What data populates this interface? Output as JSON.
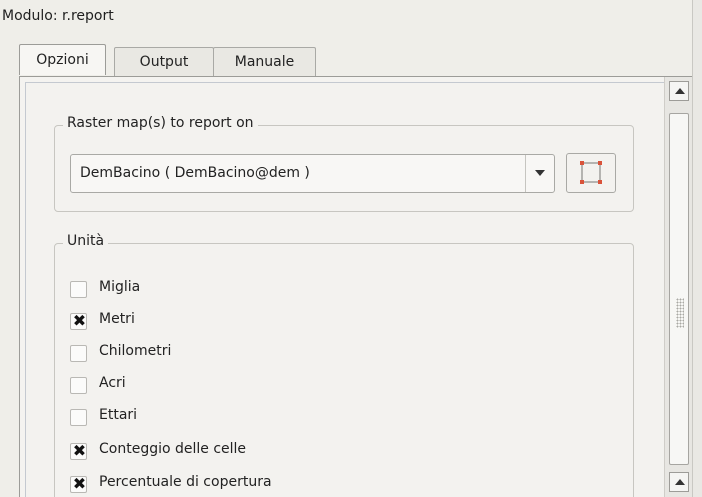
{
  "window": {
    "title": "Modulo: r.report"
  },
  "tabs": [
    {
      "label": "Opzioni",
      "active": true
    },
    {
      "label": "Output",
      "active": false
    },
    {
      "label": "Manuale",
      "active": false
    }
  ],
  "raster_group": {
    "legend": "Raster map(s) to report on",
    "combo_value": "DemBacino ( DemBacino@dem )",
    "select_button_icon": "select-features-icon"
  },
  "unita_group": {
    "legend": "Unità",
    "options": [
      {
        "label": "Miglia",
        "checked": false
      },
      {
        "label": "Metri",
        "checked": true
      },
      {
        "label": "Chilometri",
        "checked": false
      },
      {
        "label": "Acri",
        "checked": false
      },
      {
        "label": "Ettari",
        "checked": false
      },
      {
        "label": "Conteggio delle celle",
        "checked": true
      },
      {
        "label": "Percentuale di copertura",
        "checked": true
      }
    ]
  },
  "colors": {
    "accent_handle": "#d9533a",
    "check_mark": "#111111"
  }
}
